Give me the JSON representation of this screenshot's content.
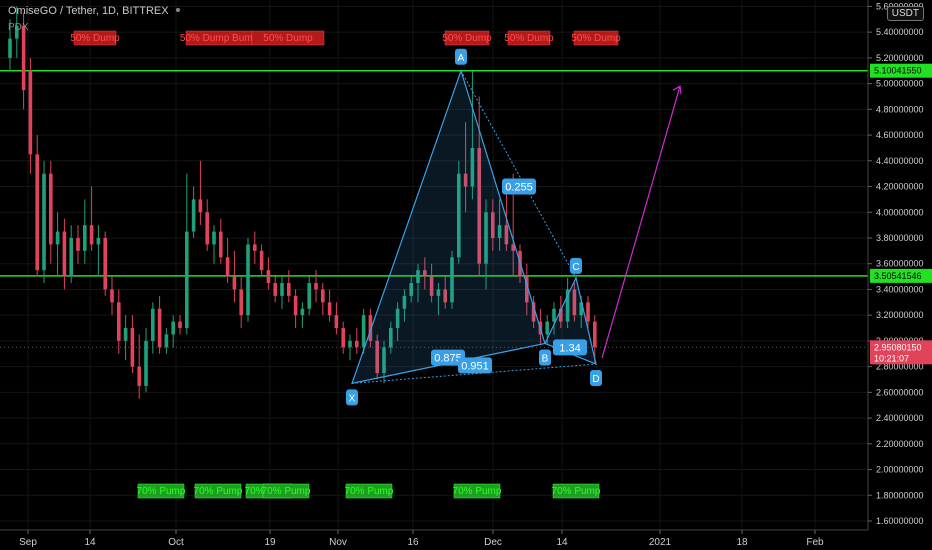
{
  "header": {
    "title": "OmiseGO / Tether, 1D, BITTREX",
    "sub": "PDX",
    "currency": "USDT"
  },
  "colors": {
    "up": "#1fa07a",
    "down": "#e0435a",
    "green_line": "#22e022",
    "pattern": "#3aa0e6",
    "arrow": "#d22ad2",
    "pump_bg": "#1f9f1f",
    "dump_bg": "#b31b1b"
  },
  "chart_data": {
    "type": "candlestick",
    "title": "OmiseGO / Tether, 1D, BITTREX",
    "y_axis": {
      "ticks": [
        "5.60000000",
        "5.40000000",
        "5.20000000",
        "5.00000000",
        "4.80000000",
        "4.60000000",
        "4.40000000",
        "4.20000000",
        "4.00000000",
        "3.80000000",
        "3.60000000",
        "3.40000000",
        "3.20000000",
        "3.00000000",
        "2.80000000",
        "2.60000000",
        "2.40000000",
        "2.20000000",
        "2.00000000",
        "1.80000000",
        "1.60000000"
      ],
      "range": [
        1.53,
        5.65
      ]
    },
    "x_axis": {
      "labels": [
        "Sep",
        "14",
        "Oct",
        "19",
        "Nov",
        "16",
        "Dec",
        "14",
        "2021",
        "18",
        "Feb"
      ]
    },
    "horizontal_lines": [
      {
        "value": 5.1004155,
        "label": "5.10041550"
      },
      {
        "value": 3.50541546,
        "label": "3.50541546"
      }
    ],
    "current_price": {
      "label": "2.95080150",
      "countdown": "10:21:07"
    },
    "harmonic_pattern": {
      "points": [
        {
          "label": "X",
          "price": 2.67
        },
        {
          "label": "A",
          "price": 5.1
        },
        {
          "label": "B",
          "price": 2.98
        },
        {
          "label": "C",
          "price": 3.49
        },
        {
          "label": "D",
          "price": 2.82
        }
      ],
      "ratios": [
        "0.255",
        "0.875",
        "0.951",
        "1.34"
      ]
    },
    "annotations": {
      "pump": [
        "70% Pump",
        "70% Pump",
        "70% Pump",
        "70% Pump",
        "70% Pump",
        "70% Pump",
        "70% Pump"
      ],
      "dump": [
        "50% Dump",
        "50% Dump Bump",
        "50% Dump",
        "50% Dump",
        "50% Dump",
        "50% Dump"
      ]
    },
    "candles": [
      [
        5.2,
        5.5,
        5.1,
        5.35
      ],
      [
        5.35,
        5.6,
        5.2,
        5.45
      ],
      [
        5.45,
        5.55,
        4.8,
        4.95
      ],
      [
        5.1,
        5.2,
        4.3,
        4.45
      ],
      [
        4.45,
        4.6,
        3.5,
        3.55
      ],
      [
        3.55,
        4.4,
        3.45,
        4.3
      ],
      [
        4.3,
        4.4,
        3.6,
        3.75
      ],
      [
        3.75,
        4.0,
        3.5,
        3.85
      ],
      [
        3.85,
        3.95,
        3.4,
        3.5
      ],
      [
        3.5,
        3.9,
        3.45,
        3.8
      ],
      [
        3.8,
        3.9,
        3.6,
        3.7
      ],
      [
        3.7,
        4.1,
        3.6,
        3.9
      ],
      [
        3.9,
        4.2,
        3.7,
        3.75
      ],
      [
        3.75,
        3.9,
        3.5,
        3.8
      ],
      [
        3.8,
        3.85,
        3.35,
        3.4
      ],
      [
        3.4,
        3.5,
        3.2,
        3.3
      ],
      [
        3.3,
        3.4,
        2.9,
        3.0
      ],
      [
        3.0,
        3.2,
        2.85,
        3.1
      ],
      [
        3.1,
        3.2,
        2.75,
        2.8
      ],
      [
        2.8,
        3.05,
        2.55,
        2.65
      ],
      [
        2.65,
        3.1,
        2.6,
        3.0
      ],
      [
        3.0,
        3.3,
        2.9,
        3.25
      ],
      [
        3.25,
        3.35,
        2.9,
        2.95
      ],
      [
        2.95,
        3.1,
        2.9,
        3.05
      ],
      [
        3.05,
        3.2,
        2.95,
        3.15
      ],
      [
        3.15,
        3.2,
        3.05,
        3.1
      ],
      [
        3.1,
        4.3,
        3.05,
        3.85
      ],
      [
        3.85,
        4.2,
        3.8,
        4.1
      ],
      [
        4.1,
        4.4,
        3.9,
        4.0
      ],
      [
        4.0,
        4.1,
        3.7,
        3.75
      ],
      [
        3.75,
        3.9,
        3.6,
        3.85
      ],
      [
        3.85,
        3.95,
        3.6,
        3.65
      ],
      [
        3.65,
        3.8,
        3.45,
        3.5
      ],
      [
        3.5,
        3.7,
        3.3,
        3.4
      ],
      [
        3.4,
        3.5,
        3.1,
        3.2
      ],
      [
        3.2,
        3.8,
        3.15,
        3.75
      ],
      [
        3.75,
        3.85,
        3.6,
        3.7
      ],
      [
        3.7,
        3.75,
        3.5,
        3.55
      ],
      [
        3.55,
        3.65,
        3.4,
        3.45
      ],
      [
        3.45,
        3.5,
        3.3,
        3.35
      ],
      [
        3.35,
        3.5,
        3.25,
        3.45
      ],
      [
        3.45,
        3.55,
        3.3,
        3.35
      ],
      [
        3.35,
        3.4,
        3.1,
        3.2
      ],
      [
        3.2,
        3.3,
        3.1,
        3.25
      ],
      [
        3.25,
        3.5,
        3.2,
        3.45
      ],
      [
        3.45,
        3.55,
        3.3,
        3.4
      ],
      [
        3.4,
        3.45,
        3.2,
        3.3
      ],
      [
        3.3,
        3.4,
        3.15,
        3.2
      ],
      [
        3.2,
        3.3,
        3.05,
        3.1
      ],
      [
        3.1,
        3.15,
        2.9,
        2.95
      ],
      [
        2.95,
        3.05,
        2.85,
        3.0
      ],
      [
        3.0,
        3.1,
        2.9,
        2.95
      ],
      [
        2.95,
        3.25,
        2.9,
        3.2
      ],
      [
        3.2,
        3.25,
        2.95,
        3.0
      ],
      [
        3.0,
        3.05,
        2.7,
        2.75
      ],
      [
        2.75,
        3.0,
        2.67,
        2.95
      ],
      [
        2.95,
        3.15,
        2.9,
        3.1
      ],
      [
        3.1,
        3.3,
        3.0,
        3.25
      ],
      [
        3.25,
        3.4,
        3.15,
        3.35
      ],
      [
        3.35,
        3.5,
        3.3,
        3.45
      ],
      [
        3.45,
        3.6,
        3.3,
        3.55
      ],
      [
        3.55,
        3.65,
        3.4,
        3.5
      ],
      [
        3.5,
        3.6,
        3.3,
        3.35
      ],
      [
        3.35,
        3.45,
        3.2,
        3.4
      ],
      [
        3.4,
        3.5,
        3.25,
        3.3
      ],
      [
        3.3,
        3.7,
        3.25,
        3.65
      ],
      [
        3.65,
        4.4,
        3.6,
        4.3
      ],
      [
        4.3,
        4.7,
        4.0,
        4.2
      ],
      [
        4.2,
        5.1,
        4.1,
        4.5
      ],
      [
        4.5,
        4.9,
        3.5,
        3.6
      ],
      [
        3.6,
        4.1,
        3.4,
        4.0
      ],
      [
        4.0,
        4.1,
        3.7,
        3.8
      ],
      [
        3.8,
        4.1,
        3.7,
        3.9
      ],
      [
        3.9,
        4.2,
        3.7,
        3.75
      ],
      [
        3.75,
        4.3,
        3.5,
        3.7
      ],
      [
        3.7,
        3.75,
        3.45,
        3.5
      ],
      [
        3.5,
        3.6,
        3.2,
        3.3
      ],
      [
        3.3,
        3.35,
        3.1,
        3.15
      ],
      [
        3.15,
        3.25,
        2.98,
        3.05
      ],
      [
        3.05,
        3.2,
        2.98,
        3.15
      ],
      [
        3.15,
        3.3,
        3.05,
        3.25
      ],
      [
        3.25,
        3.35,
        3.1,
        3.15
      ],
      [
        3.15,
        3.49,
        3.1,
        3.4
      ],
      [
        3.4,
        3.45,
        3.15,
        3.2
      ],
      [
        3.2,
        3.35,
        3.1,
        3.3
      ],
      [
        3.3,
        3.35,
        3.1,
        3.15
      ],
      [
        3.15,
        3.2,
        2.82,
        2.95
      ]
    ]
  }
}
